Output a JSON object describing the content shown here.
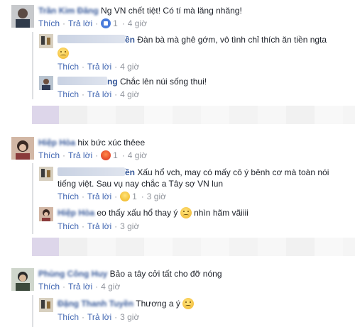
{
  "labels": {
    "like": "Thích",
    "reply": "Trả lời",
    "dot": "·"
  },
  "threads": [
    {
      "comment": {
        "author": "Trần Kim Đăng",
        "text": "Ng VN chết tiệt! Có tí mà lăng nhăng!",
        "reaction": "like-icon",
        "reaction_count": "1",
        "time": "4 giờ"
      },
      "replies": [
        {
          "author_tail": "ền",
          "text": "Đàn bà mà ghê gớm, vô tình chỉ thích ăn tiền ngta",
          "time": "4 giờ"
        },
        {
          "author_tail": "ng",
          "text": "Chắc lên núi sống thui!",
          "time": "4 giờ"
        }
      ]
    },
    {
      "comment": {
        "author": "Hiệp Hòa",
        "text": "hix bức xúc thêee",
        "reaction": "angry-icon",
        "reaction_count": "1",
        "time": "4 giờ"
      },
      "replies": [
        {
          "author_tail": "ền",
          "text_line1": "Xấu hổ vch, may có mấy cô ý bênh cơ mà toàn nói",
          "text_line2": "tiếng việt. Sau vụ nay chắc a Tây sợ VN lun",
          "reaction": "sad-icon",
          "reaction_count": "1",
          "time": "3 giờ"
        },
        {
          "author": "Hiệp Hòa",
          "text_before": "eo thấy xấu hổ thay ý",
          "text_after": "nhìn hãm vãiiii",
          "time": "3 giờ"
        }
      ]
    },
    {
      "comment": {
        "author": "Phùng Công Huy",
        "text": "Bảo a tây cởi tất cho đỡ nóng",
        "time": "4 giờ"
      },
      "replies": [
        {
          "author": "Đặng Thanh Tuyền",
          "text": "Thương a ý",
          "time": "3 giờ"
        }
      ]
    }
  ],
  "colors": {
    "link": "#365899",
    "action": "#4267b2",
    "meta": "#90949c",
    "reply_line": "#dddfe2"
  }
}
